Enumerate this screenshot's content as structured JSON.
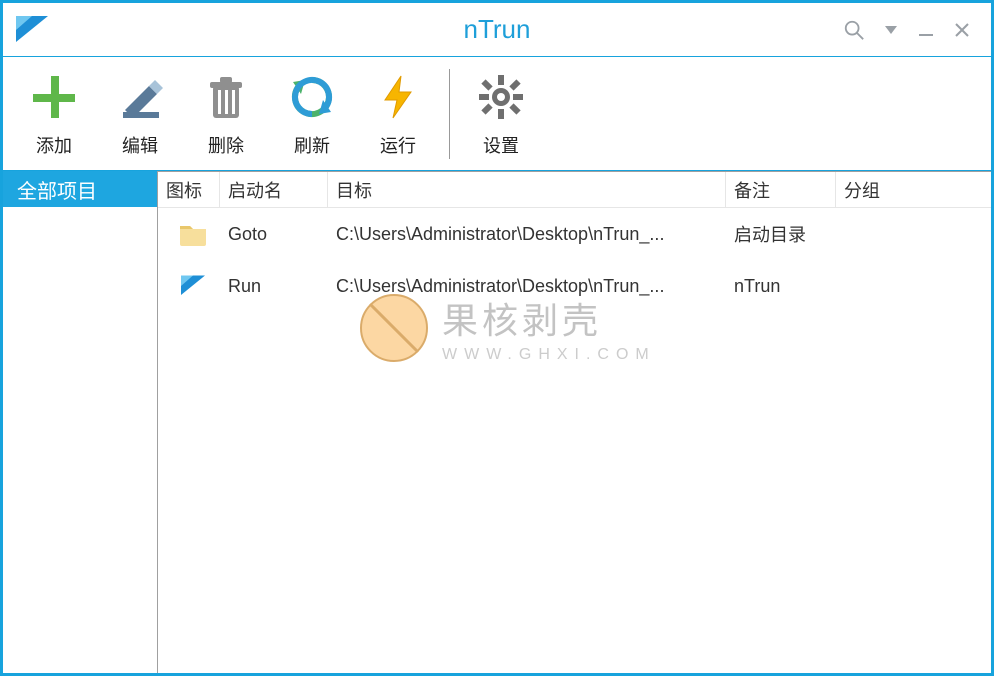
{
  "window": {
    "title": "nTrun"
  },
  "toolbar": {
    "add": "添加",
    "edit": "编辑",
    "delete": "删除",
    "refresh": "刷新",
    "run": "运行",
    "settings": "设置"
  },
  "sidebar": {
    "all_items": "全部项目"
  },
  "columns": {
    "icon": "图标",
    "name": "启动名",
    "target": "目标",
    "remark": "备注",
    "group": "分组"
  },
  "rows": [
    {
      "icon": "folder",
      "name": "Goto",
      "target": "C:\\Users\\Administrator\\Desktop\\nTrun_...",
      "remark": "启动目录",
      "group": ""
    },
    {
      "icon": "app-logo",
      "name": "Run",
      "target": "C:\\Users\\Administrator\\Desktop\\nTrun_...",
      "remark": "nTrun",
      "group": ""
    }
  ],
  "watermark": {
    "text": "果核剥壳",
    "url": "WWW.GHXI.COM"
  }
}
